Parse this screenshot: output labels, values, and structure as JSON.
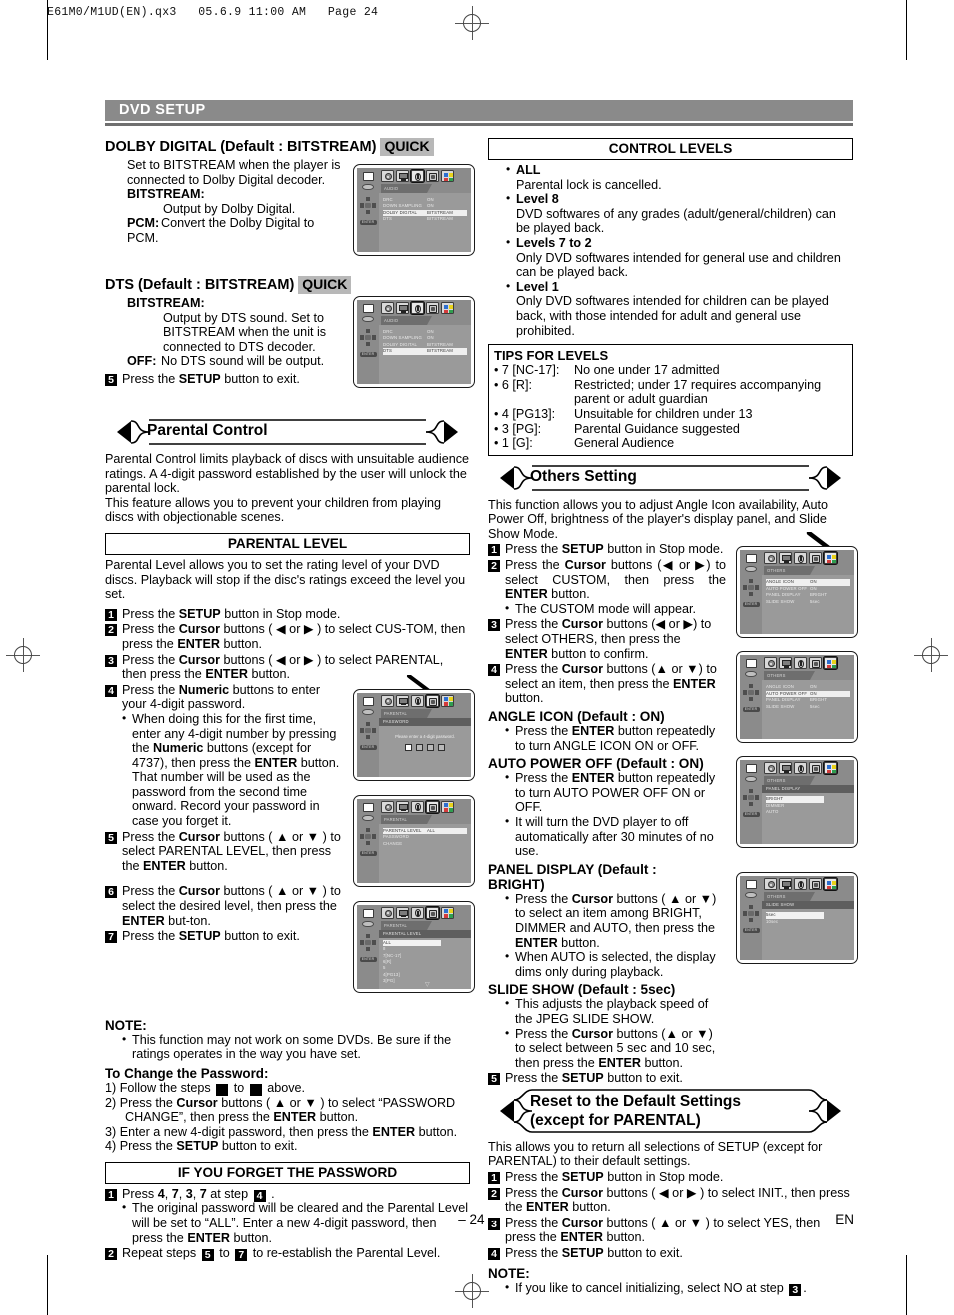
{
  "job_header": "E61M0/M1UD(EN).qx3   05.6.9 11:00 AM   Page 24",
  "section_bar": "DVD SETUP",
  "footer": {
    "page": "– 24 –",
    "lang": "EN"
  },
  "left": {
    "dolby": {
      "heading": "DOLBY DIGITAL (Default : BITSTREAM)",
      "quick": "QUICK",
      "body": "Set to BITSTREAM when the player is connected to Dolby Digital decoder.",
      "bitstream_label": "BITSTREAM",
      "bitstream_text": "Output by Dolby Digital.",
      "pcm_label": "PCM",
      "pcm_text": "Convert the Dolby Digital to PCM."
    },
    "dts": {
      "heading": "DTS (Default : BITSTREAM)",
      "quick": "QUICK",
      "bitstream_label": "BITSTREAM",
      "bitstream_text": "Output by DTS sound. Set to BITSTREAM when the unit is connected to DTS decoder.",
      "off_label": "OFF",
      "off_text": "No DTS sound will be output.",
      "step5": "Press the SETUP button to exit."
    },
    "parental_control": {
      "ribbon": "Parental Control",
      "p1": "Parental Control limits playback of discs with unsuitable audience ratings. A 4-digit password established by the user will unlock the parental lock.",
      "p2": "This feature allows you to prevent your children from playing discs  with objectionable scenes."
    },
    "parental_level": {
      "title": "PARENTAL LEVEL",
      "intro": "Parental Level allows you to set the rating level of your DVD discs. Playback will stop if the disc's ratings exceed the level you set.",
      "steps": [
        "Press the SETUP button in Stop mode.",
        "Press the Cursor buttons ( ◀ or ▶ ) to select CUSTOM, then press the ENTER button.",
        "Press the Cursor buttons ( ◀ or ▶ ) to select PARENTAL, then press the ENTER button.",
        "Press the Numeric buttons to enter your 4-digit password.",
        "Press the Cursor buttons ( ▲ or ▼ ) to select PARENTAL LEVEL, then press the ENTER button.",
        "Press the Cursor buttons ( ▲ or ▼ ) to select the desired level, then press the ENTER button.",
        "Press the SETUP button to exit."
      ],
      "step4_bullet": "When doing this for the first time, enter any 4-digit number by pressing the Numeric buttons (except for 4737), then press the ENTER button. That number will be used as the password from the second time onward. Record your password in case you forget it.",
      "note_label": "NOTE:",
      "note_bullet": "This function may not work on some DVDs. Be sure if the ratings operates in the way you have set.",
      "change_pw_title": "To Change the Password:",
      "change_pw_steps": [
        "Follow the steps ■ to ■ above.",
        "Press the Cursor buttons ( ▲ or ▼ ) to select “PASSWORD CHANGE”, then press the ENTER button.",
        "Enter a new 4-digit password, then press the ENTER button.",
        "Press the SETUP button to exit."
      ]
    },
    "forgot_password": {
      "title": "IF YOU FORGET THE PASSWORD",
      "step1": "Press 4, 7, 3, 7 at step",
      "step1_ref": "4",
      "step1_bullet": "The original password will be cleared and the Parental Level will be set to “ALL”. Enter a new 4-digit password, then press the ENTER button.",
      "step2_a": "Repeat steps",
      "step2_ref1": "5",
      "step2_mid": "to",
      "step2_ref2": "7",
      "step2_b": "to re-establish the Parental Level."
    }
  },
  "right": {
    "control_levels": {
      "title": "CONTROL LEVELS",
      "items": [
        {
          "label": "ALL",
          "text": "Parental lock is cancelled."
        },
        {
          "label": "Level 8",
          "text": "DVD softwares of any grades (adult/general/children) can be played back."
        },
        {
          "label": "Levels 7 to 2",
          "text": "Only DVD softwares intended for general use and children can be played back."
        },
        {
          "label": "Level 1",
          "text": "Only DVD softwares intended for children can be played back, with those intended for adult and general use prohibited."
        }
      ]
    },
    "tips": {
      "title": "TIPS FOR LEVELS",
      "rows": [
        {
          "k": "7 [NC-17]:",
          "v": "No one under 17 admitted"
        },
        {
          "k": "6 [R]:",
          "v": "Restricted; under 17 requires accompanying parent or adult guardian"
        },
        {
          "k": "4 [PG13]:",
          "v": "Unsuitable for children under 13"
        },
        {
          "k": "3 [PG]:",
          "v": "Parental Guidance suggested"
        },
        {
          "k": "1 [G]:",
          "v": "General Audience"
        }
      ]
    },
    "others_setting": {
      "ribbon": "Others Setting",
      "intro": "This function allows you to adjust Angle Icon availability, Auto Power Off, brightness of the player's display panel, and Slide Show Mode.",
      "steps": [
        "Press the SETUP button in Stop mode.",
        "Press the Cursor buttons (◀ or ▶) to select CUSTOM, then press the ENTER button.",
        "Press the Cursor buttons (◀ or ▶) to select OTHERS, then press the ENTER button to confirm.",
        "Press the Cursor buttons (▲ or ▼) to select an item, then press the ENTER button."
      ],
      "step2_bullet": "The CUSTOM mode will appear.",
      "angle_icon": {
        "heading": "ANGLE ICON (Default : ON)",
        "bullets": [
          "Press the ENTER button repeatedly to turn ANGLE ICON ON or OFF."
        ]
      },
      "auto_power_off": {
        "heading": "AUTO POWER OFF (Default : ON)",
        "bullets": [
          "Press the ENTER button repeatedly to turn AUTO POWER OFF ON or OFF.",
          "It will turn the DVD player to off automatically after 30 minutes of no use."
        ]
      },
      "panel_display": {
        "heading": "PANEL DISPLAY (Default : BRIGHT)",
        "bullets": [
          "Press the Cursor buttons ( ▲ or ▼) to select an item among BRIGHT, DIMMER and AUTO, then press the ENTER button.",
          "When AUTO is selected, the display dims only during playback."
        ]
      },
      "slide_show": {
        "heading": "SLIDE SHOW (Default : 5sec)",
        "bullets": [
          "This adjusts the playback speed of the JPEG SLIDE SHOW.",
          "Press the Cursor buttons (▲ or ▼) to select between 5 sec and 10 sec, then press the ENTER button."
        ]
      },
      "step5": "Press the SETUP button to exit."
    },
    "reset": {
      "ribbon_line1": "Reset to the Default Settings",
      "ribbon_line2": "(except for PARENTAL)",
      "intro": "This allows you to return all selections of SETUP (except for PARENTAL) to their default settings.",
      "steps": [
        "Press the SETUP button in Stop mode.",
        "Press the Cursor buttons ( ◀ or ▶ ) to select INIT., then press the ENTER button.",
        "Press the Cursor buttons ( ▲ or ▼ ) to select YES, then press the ENTER button.",
        "Press the SETUP button to exit."
      ],
      "note_label": "NOTE:",
      "note_a": "If you like to cancel initializing, select NO at step",
      "note_ref": "3"
    }
  },
  "osd": {
    "audio_dolby": {
      "tab": "AUDIO",
      "rows": [
        {
          "k": "DRC",
          "v": "ON",
          "hl": false
        },
        {
          "k": "DOWN SAMPLING",
          "v": "ON",
          "hl": false
        },
        {
          "k": "DOLBY DIGITAL",
          "v": "BITSTREAM",
          "hl": true
        },
        {
          "k": "DTS",
          "v": "BITSTREAM",
          "hl": false
        }
      ]
    },
    "audio_dts": {
      "tab": "AUDIO",
      "rows": [
        {
          "k": "DRC",
          "v": "ON",
          "hl": false
        },
        {
          "k": "DOWN SAMPLING",
          "v": "ON",
          "hl": false
        },
        {
          "k": "DOLBY DIGITAL",
          "v": "BITSTREAM",
          "hl": false
        },
        {
          "k": "DTS",
          "v": "BITSTREAM",
          "hl": true
        }
      ]
    },
    "parental_password": {
      "tab": "PARENTAL",
      "sub": "PASSWORD",
      "message": "Please enter a 4-digit password."
    },
    "parental_menu": {
      "tab": "PARENTAL",
      "rows": [
        {
          "k": "PARENTAL LEVEL",
          "v": "ALL",
          "hl": true
        },
        {
          "k": "PASSWORD CHANGE",
          "v": "",
          "hl": false
        }
      ]
    },
    "parental_levels": {
      "tab": "PARENTAL",
      "sub": "PARENTAL LEVEL",
      "items": [
        "ALL",
        "8",
        "7[NC-17]",
        "6[R]",
        "5",
        "4[PG13]",
        "3[PG]"
      ]
    },
    "others_angle": {
      "tab": "OTHERS",
      "rows": [
        {
          "k": "ANGLE ICON",
          "v": "ON",
          "hl": true
        },
        {
          "k": "AUTO POWER OFF",
          "v": "ON",
          "hl": false
        },
        {
          "k": "PANEL DISPLAY",
          "v": "BRIGHT",
          "hl": false
        },
        {
          "k": "SLIDE SHOW",
          "v": "5sec",
          "hl": false
        }
      ]
    },
    "others_auto": {
      "tab": "OTHERS",
      "rows": [
        {
          "k": "ANGLE ICON",
          "v": "ON",
          "hl": false
        },
        {
          "k": "AUTO POWER OFF",
          "v": "ON",
          "hl": true
        },
        {
          "k": "PANEL DISPLAY",
          "v": "BRIGHT",
          "hl": false
        },
        {
          "k": "SLIDE SHOW",
          "v": "5sec",
          "hl": false
        }
      ]
    },
    "others_panel": {
      "tab": "OTHERS",
      "sub": "PANEL DISPLAY",
      "items": [
        "BRIGHT",
        "DIMMER",
        "AUTO"
      ]
    },
    "others_slide": {
      "tab": "OTHERS",
      "sub": "SLIDE SHOW",
      "items": [
        "5sec",
        "10sec"
      ]
    },
    "icon_names": [
      "disc-icon",
      "monitor-icon",
      "speaker-icon",
      "lock-icon",
      "others-icon"
    ]
  }
}
